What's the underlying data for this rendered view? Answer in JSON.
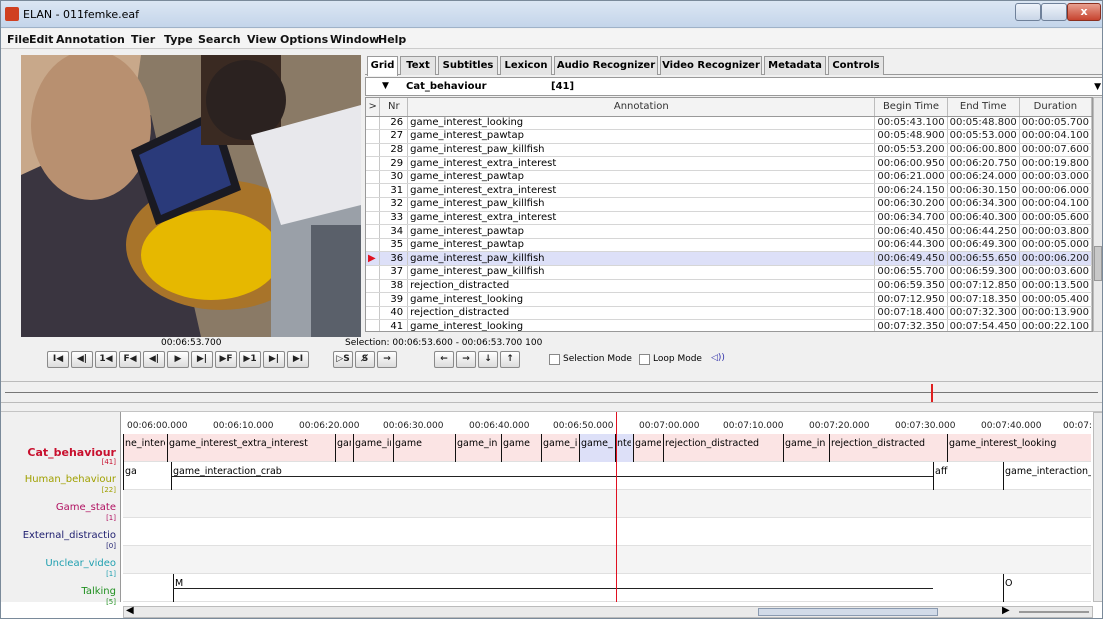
{
  "window": {
    "title": "ELAN - 011femke.eaf",
    "close_glyph": "x"
  },
  "menu": [
    "File",
    "Edit",
    "Annotation",
    "Tier",
    "Type",
    "Search",
    "View",
    "Options",
    "Window",
    "Help"
  ],
  "tabs": [
    "Grid",
    "Text",
    "Subtitles",
    "Lexicon",
    "Audio Recognizer",
    "Video Recognizer",
    "Metadata",
    "Controls"
  ],
  "active_tab": "Grid",
  "tier_select": {
    "name": "Cat_behaviour",
    "count": "[41]"
  },
  "grid": {
    "columns": [
      "Nr",
      "Annotation",
      "Begin Time",
      "End Time",
      "Duration"
    ],
    "col_glyph": ">",
    "selected_nr": "36",
    "rows": [
      {
        "nr": "26",
        "annotation": "game_interest_looking",
        "begin": "00:05:43.100",
        "end": "00:05:48.800",
        "duration": "00:00:05.700"
      },
      {
        "nr": "27",
        "annotation": "game_interest_pawtap",
        "begin": "00:05:48.900",
        "end": "00:05:53.000",
        "duration": "00:00:04.100"
      },
      {
        "nr": "28",
        "annotation": "game_interest_paw_killfish",
        "begin": "00:05:53.200",
        "end": "00:06:00.800",
        "duration": "00:00:07.600"
      },
      {
        "nr": "29",
        "annotation": "game_interest_extra_interest",
        "begin": "00:06:00.950",
        "end": "00:06:20.750",
        "duration": "00:00:19.800"
      },
      {
        "nr": "30",
        "annotation": "game_interest_pawtap",
        "begin": "00:06:21.000",
        "end": "00:06:24.000",
        "duration": "00:00:03.000"
      },
      {
        "nr": "31",
        "annotation": "game_interest_extra_interest",
        "begin": "00:06:24.150",
        "end": "00:06:30.150",
        "duration": "00:00:06.000"
      },
      {
        "nr": "32",
        "annotation": "game_interest_paw_killfish",
        "begin": "00:06:30.200",
        "end": "00:06:34.300",
        "duration": "00:00:04.100"
      },
      {
        "nr": "33",
        "annotation": "game_interest_extra_interest",
        "begin": "00:06:34.700",
        "end": "00:06:40.300",
        "duration": "00:00:05.600"
      },
      {
        "nr": "34",
        "annotation": "game_interest_pawtap",
        "begin": "00:06:40.450",
        "end": "00:06:44.250",
        "duration": "00:00:03.800"
      },
      {
        "nr": "35",
        "annotation": "game_interest_pawtap",
        "begin": "00:06:44.300",
        "end": "00:06:49.300",
        "duration": "00:00:05.000"
      },
      {
        "nr": "36",
        "annotation": "game_interest_paw_killfish",
        "begin": "00:06:49.450",
        "end": "00:06:55.650",
        "duration": "00:00:06.200"
      },
      {
        "nr": "37",
        "annotation": "game_interest_paw_killfish",
        "begin": "00:06:55.700",
        "end": "00:06:59.300",
        "duration": "00:00:03.600"
      },
      {
        "nr": "38",
        "annotation": "rejection_distracted",
        "begin": "00:06:59.350",
        "end": "00:07:12.850",
        "duration": "00:00:13.500"
      },
      {
        "nr": "39",
        "annotation": "game_interest_looking",
        "begin": "00:07:12.950",
        "end": "00:07:18.350",
        "duration": "00:00:05.400"
      },
      {
        "nr": "40",
        "annotation": "rejection_distracted",
        "begin": "00:07:18.400",
        "end": "00:07:32.300",
        "duration": "00:00:13.900"
      },
      {
        "nr": "41",
        "annotation": "game_interest_looking",
        "begin": "00:07:32.350",
        "end": "00:07:54.450",
        "duration": "00:00:22.100"
      }
    ]
  },
  "media": {
    "current_time": "00:06:53.700",
    "selection": "Selection: 00:06:53.600 - 00:06:53.700  100",
    "buttons": [
      "I◀",
      "◀|",
      "1◀",
      "F◀",
      "◀|",
      "▶",
      "▶|",
      "▶F",
      "▶1",
      "▶|",
      "▶I"
    ],
    "sel_buttons": [
      "▷S",
      "S̸",
      "→"
    ],
    "nav_buttons": [
      "←",
      "→",
      "↓",
      "↑"
    ],
    "selection_mode": "Selection Mode",
    "loop_mode": "Loop Mode",
    "volume_icon": "◁))"
  },
  "timeline": {
    "ticks": [
      "00:06:00.000",
      "00:06:10.000",
      "00:06:20.000",
      "00:06:30.000",
      "00:06:40.000",
      "00:06:50.000",
      "00:07:00.000",
      "00:07:10.000",
      "00:07:20.000",
      "00:07:30.000",
      "00:07:40.000",
      "00:07:"
    ],
    "tiers": [
      {
        "name": "Cat_behaviour",
        "count": "[41]",
        "color": "#c8102e"
      },
      {
        "name": "Human_behaviour",
        "count": "[22]",
        "color": "#a0a000"
      },
      {
        "name": "Game_state",
        "count": "[1]",
        "color": "#b01060"
      },
      {
        "name": "External_distractio",
        "count": "[0]",
        "color": "#202070"
      },
      {
        "name": "Unclear_video",
        "count": "[1]",
        "color": "#20a0b0"
      },
      {
        "name": "Talking",
        "count": "[5]",
        "color": "#209020"
      }
    ],
    "cat_annotations": [
      "ne_intere",
      "game_interest_extra_interest",
      "gam",
      "game_int",
      "game",
      "game_int",
      "game",
      "game_i",
      "game_",
      "nte",
      "game",
      "rejection_distracted",
      "game_in",
      "rejection_distracted",
      "game_interest_looking"
    ],
    "human_annotations": [
      "ga",
      "game_interaction_crab",
      "aff",
      "game_interaction_"
    ],
    "talking_annotations": [
      "M",
      "O"
    ]
  }
}
